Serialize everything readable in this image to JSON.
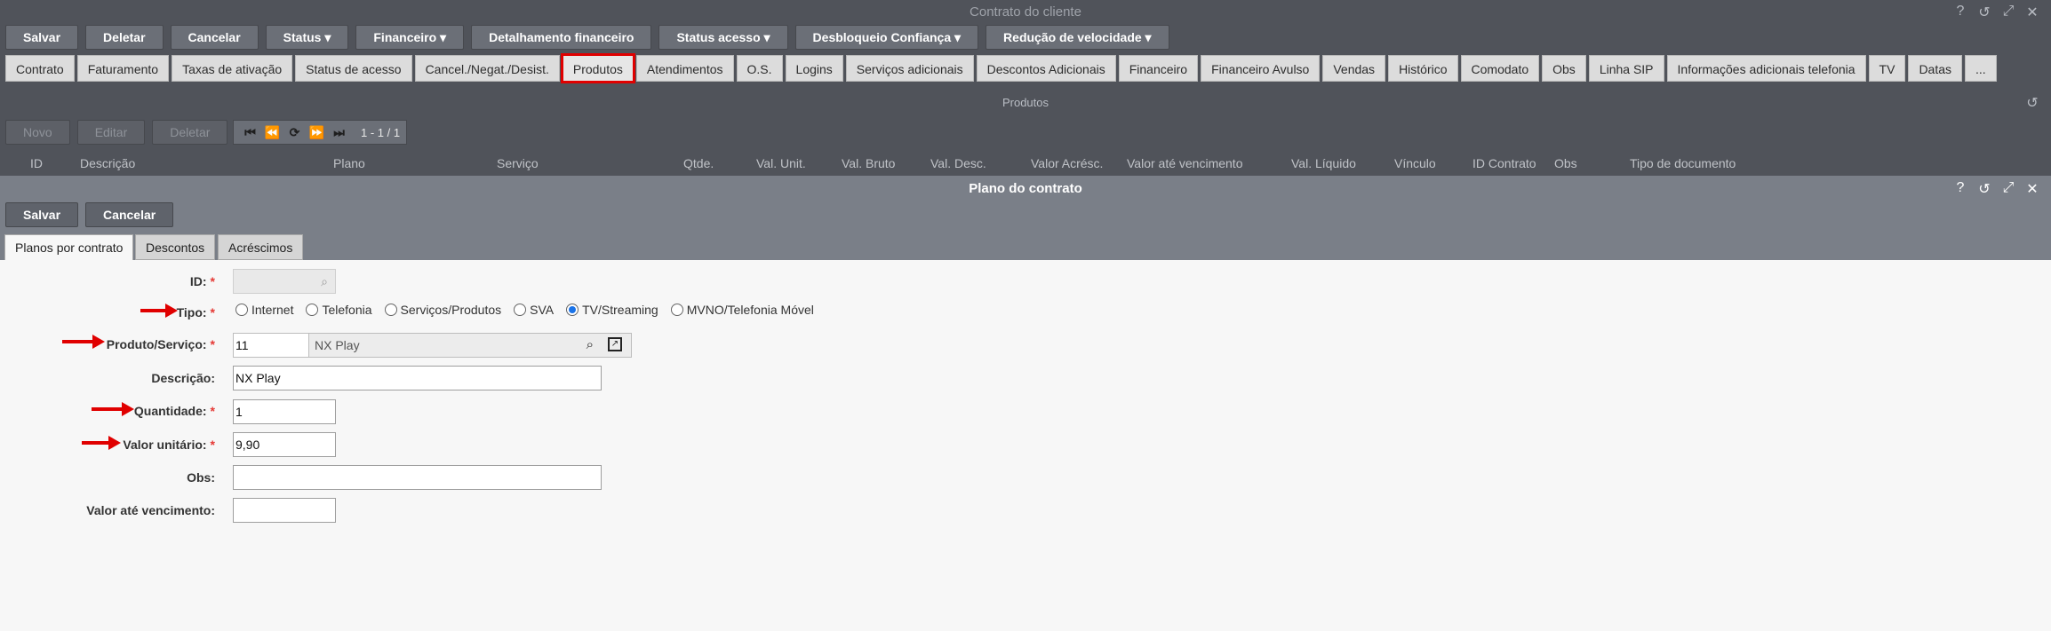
{
  "window": {
    "title": "Contrato do cliente"
  },
  "toolbar": [
    {
      "label": "Salvar"
    },
    {
      "label": "Deletar"
    },
    {
      "label": "Cancelar"
    },
    {
      "label": "Status ▾"
    },
    {
      "label": "Financeiro ▾"
    },
    {
      "label": "Detalhamento financeiro"
    },
    {
      "label": "Status acesso ▾"
    },
    {
      "label": "Desbloqueio Confiança ▾"
    },
    {
      "label": "Redução de velocidade ▾"
    }
  ],
  "tabs": [
    "Contrato",
    "Faturamento",
    "Taxas de ativação",
    "Status de acesso",
    "Cancel./Negat./Desist.",
    "Produtos",
    "Atendimentos",
    "O.S.",
    "Logins",
    "Serviços adicionais",
    "Descontos Adicionais",
    "Financeiro",
    "Financeiro Avulso",
    "Vendas",
    "Histórico",
    "Comodato",
    "Obs",
    "Linha SIP",
    "Informações adicionais telefonia",
    "TV",
    "Datas",
    "..."
  ],
  "products": {
    "section_title": "Produtos",
    "buttons": {
      "novo": "Novo",
      "editar": "Editar",
      "deletar": "Deletar"
    },
    "pager_count": "1 - 1 / 1",
    "columns": [
      "ID",
      "Descrição",
      "Plano",
      "Serviço",
      "Qtde.",
      "Val. Unit.",
      "Val. Bruto",
      "Val. Desc.",
      "Valor Acrésc.",
      "Valor até vencimento",
      "Val. Líquido",
      "Vínculo",
      "ID Contrato",
      "Obs",
      "Tipo de documento"
    ]
  },
  "modal": {
    "title": "Plano do contrato",
    "save": "Salvar",
    "cancel": "Cancelar",
    "tabs": [
      "Planos por contrato",
      "Descontos",
      "Acréscimos"
    ]
  },
  "form": {
    "id_label": "ID:",
    "tipo_label": "Tipo:",
    "tipo_options": [
      "Internet",
      "Telefonia",
      "Serviços/Produtos",
      "SVA",
      "TV/Streaming",
      "MVNO/Telefonia Móvel"
    ],
    "tipo_selected": "TV/Streaming",
    "produto_label": "Produto/Serviço:",
    "produto_id": "11",
    "produto_name": "NX Play",
    "descricao_label": "Descrição:",
    "descricao_value": "NX Play",
    "quantidade_label": "Quantidade:",
    "quantidade_value": "1",
    "valor_label": "Valor unitário:",
    "valor_value": "9,90",
    "obs_label": "Obs:",
    "obs_value": "",
    "venc_label": "Valor até vencimento:",
    "venc_value": ""
  },
  "colors": {
    "highlight": "#e00000",
    "radio_selected": "#1a73e8",
    "required": "#e53935"
  }
}
